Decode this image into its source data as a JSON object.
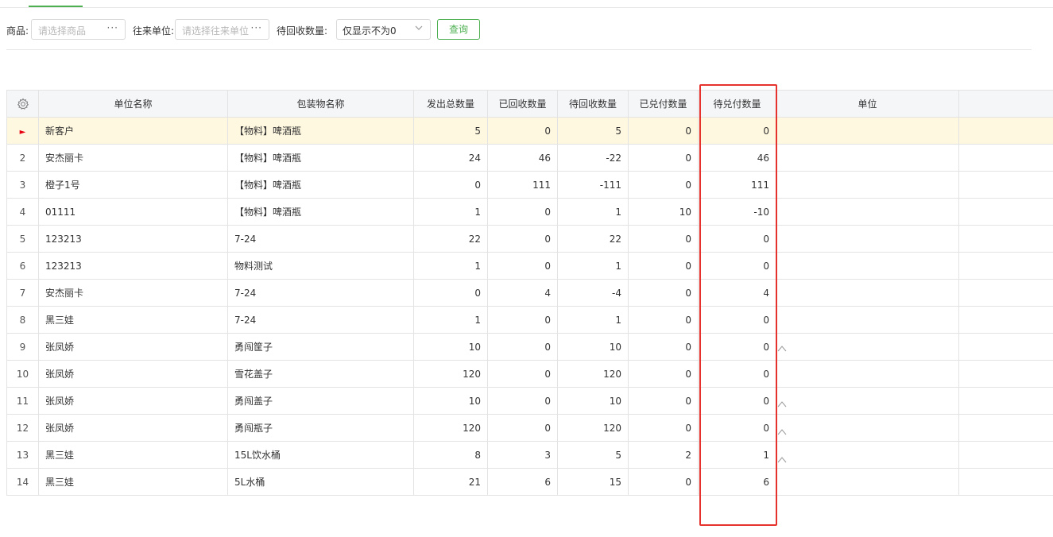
{
  "filters": {
    "product_label": "商品:",
    "product_placeholder": "请选择商品",
    "product_more": "···",
    "partner_label": "往来单位:",
    "partner_placeholder": "请选择往来单位",
    "partner_more": "···",
    "pending_label": "待回收数量:",
    "pending_value": "仅显示不为0",
    "query_button": "查询"
  },
  "table": {
    "headers": [
      "单位名称",
      "包装物名称",
      "发出总数量",
      "已回收数量",
      "待回收数量",
      "已兑付数量",
      "待兑付数量",
      "单位"
    ],
    "rows": [
      {
        "idx": "",
        "name": "新客户",
        "package": "【物料】啤酒瓶",
        "sent": "5",
        "recovered": "0",
        "pending_recover": "5",
        "redeemed": "0",
        "pending_redeem": "0",
        "unit": ""
      },
      {
        "idx": "2",
        "name": "安杰丽卡",
        "package": "【物料】啤酒瓶",
        "sent": "24",
        "recovered": "46",
        "pending_recover": "-22",
        "redeemed": "0",
        "pending_redeem": "46",
        "unit": ""
      },
      {
        "idx": "3",
        "name": "橙子1号",
        "package": "【物料】啤酒瓶",
        "sent": "0",
        "recovered": "111",
        "pending_recover": "-111",
        "redeemed": "0",
        "pending_redeem": "111",
        "unit": ""
      },
      {
        "idx": "4",
        "name": "01111",
        "package": "【物料】啤酒瓶",
        "sent": "1",
        "recovered": "0",
        "pending_recover": "1",
        "redeemed": "10",
        "pending_redeem": "-10",
        "unit": ""
      },
      {
        "idx": "5",
        "name": "123213",
        "package": "7-24",
        "sent": "22",
        "recovered": "0",
        "pending_recover": "22",
        "redeemed": "0",
        "pending_redeem": "0",
        "unit": ""
      },
      {
        "idx": "6",
        "name": "123213",
        "package": "物料测试",
        "sent": "1",
        "recovered": "0",
        "pending_recover": "1",
        "redeemed": "0",
        "pending_redeem": "0",
        "unit": ""
      },
      {
        "idx": "7",
        "name": "安杰丽卡",
        "package": "7-24",
        "sent": "0",
        "recovered": "4",
        "pending_recover": "-4",
        "redeemed": "0",
        "pending_redeem": "4",
        "unit": ""
      },
      {
        "idx": "8",
        "name": "黑三娃",
        "package": "7-24",
        "sent": "1",
        "recovered": "0",
        "pending_recover": "1",
        "redeemed": "0",
        "pending_redeem": "0",
        "unit": ""
      },
      {
        "idx": "9",
        "name": "张凤娇",
        "package": "勇闯筐子",
        "sent": "10",
        "recovered": "0",
        "pending_recover": "10",
        "redeemed": "0",
        "pending_redeem": "0",
        "unit": ""
      },
      {
        "idx": "10",
        "name": "张凤娇",
        "package": "雪花盖子",
        "sent": "120",
        "recovered": "0",
        "pending_recover": "120",
        "redeemed": "0",
        "pending_redeem": "0",
        "unit": ""
      },
      {
        "idx": "11",
        "name": "张凤娇",
        "package": "勇闯盖子",
        "sent": "10",
        "recovered": "0",
        "pending_recover": "10",
        "redeemed": "0",
        "pending_redeem": "0",
        "unit": ""
      },
      {
        "idx": "12",
        "name": "张凤娇",
        "package": "勇闯瓶子",
        "sent": "120",
        "recovered": "0",
        "pending_recover": "120",
        "redeemed": "0",
        "pending_redeem": "0",
        "unit": ""
      },
      {
        "idx": "13",
        "name": "黑三娃",
        "package": "15L饮水桶",
        "sent": "8",
        "recovered": "3",
        "pending_recover": "5",
        "redeemed": "2",
        "pending_redeem": "1",
        "unit": ""
      },
      {
        "idx": "14",
        "name": "黑三娃",
        "package": "5L水桶",
        "sent": "21",
        "recovered": "6",
        "pending_recover": "15",
        "redeemed": "0",
        "pending_redeem": "6",
        "unit": ""
      }
    ]
  },
  "icons": {
    "settings": "gear-icon",
    "current_row": "caret-right-icon",
    "dropdown": "chevron-down-icon",
    "sort_marker": "caret-up-icon"
  },
  "colors": {
    "accent": "#4caf50",
    "highlight": "#e5322d",
    "selected_row": "#fff8e1",
    "current_marker": "#e60012"
  }
}
